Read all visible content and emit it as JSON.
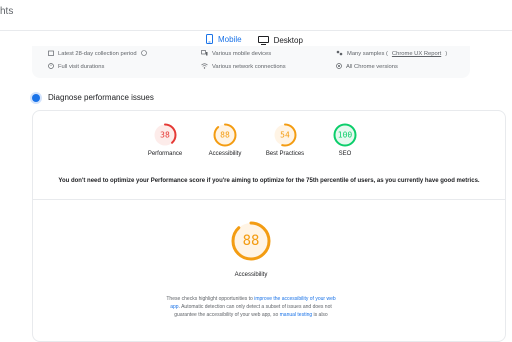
{
  "header": {
    "title_fragment": "hts"
  },
  "device_tabs": [
    {
      "label": "Mobile",
      "active": true,
      "icon": "mobile-icon"
    },
    {
      "label": "Desktop",
      "active": false,
      "icon": "desktop-icon"
    }
  ],
  "metadata": {
    "latest": "Latest 28-day collection period",
    "full_visit": "Full visit durations",
    "devices": "Various mobile devices",
    "network": "Various network connections",
    "samples_prefix": "Many samples (",
    "samples_link": "Chrome UX Report",
    "samples_suffix": ")",
    "chrome": "All Chrome versions"
  },
  "diagnose": {
    "title": "Diagnose performance issues"
  },
  "scores": [
    {
      "label": "Performance",
      "value": 38,
      "color": "#e53935",
      "bg": "#fdecea"
    },
    {
      "label": "Accessibility",
      "value": 88,
      "color": "#f39c12",
      "bg": "#fff4e5"
    },
    {
      "label": "Best Practices",
      "value": 54,
      "color": "#f39c12",
      "bg": "#fff4e5"
    },
    {
      "label": "SEO",
      "value": 100,
      "color": "#0cce6b",
      "bg": "#e6f9ef"
    }
  ],
  "notice": "You don't need to optimize your Performance score if you're aiming to optimize for the 75th percentile of users, as you currently have good metrics.",
  "focus": {
    "label": "Accessibility",
    "value": 88,
    "color": "#f39c12",
    "bg": "#fff4e5"
  },
  "description": {
    "part1": "These checks highlight opportunities to ",
    "link1": "improve the accessibility of your web app",
    "part2": ". Automatic detection can only detect a subset of issues and does not guarantee the accessibility of your web app, so ",
    "link2": "manual testing",
    "part3": " is also"
  }
}
